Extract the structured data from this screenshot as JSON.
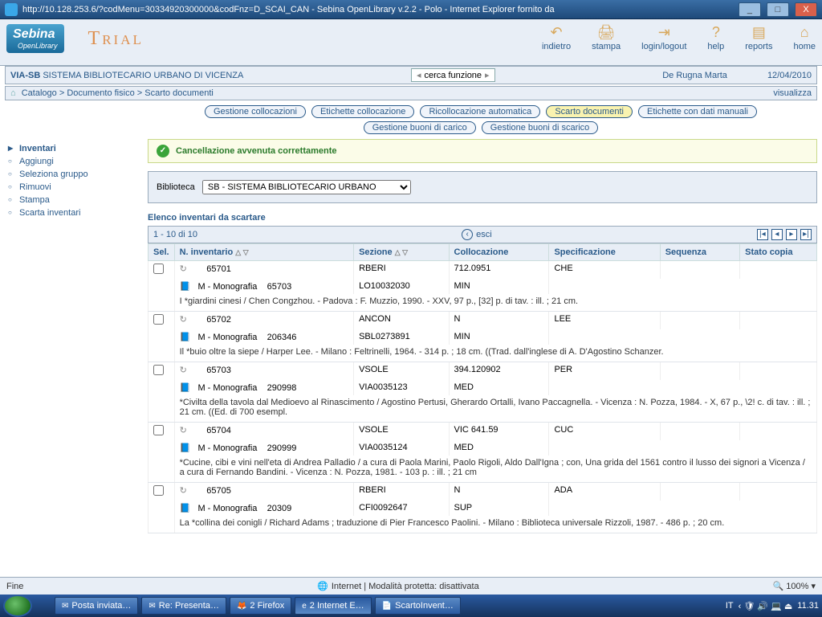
{
  "window": {
    "title": "http://10.128.253.6/?codMenu=30334920300000&codFnz=D_SCAI_CAN - Sebina OpenLibrary v.2.2 - Polo - Internet Explorer fornito da"
  },
  "brand": {
    "name": "Sebina",
    "sub": "OpenLibrary",
    "trial": "Trial"
  },
  "tb": {
    "indietro": "indietro",
    "stampa": "stampa",
    "login": "login/logout",
    "help": "help",
    "reports": "reports",
    "home": "home"
  },
  "sys": {
    "code": "VIA-SB",
    "name": "SISTEMA BIBLIOTECARIO URBANO DI VICENZA",
    "search": "cerca funzione",
    "user": "De Rugna Marta",
    "date": "12/04/2010"
  },
  "bc": {
    "a": "Catalogo",
    "b": "Documento fisico",
    "c": "Scarto documenti",
    "vis": "visualizza"
  },
  "pills": {
    "p1": "Gestione collocazioni",
    "p2": "Etichette collocazione",
    "p3": "Ricollocazione automatica",
    "p4": "Scarto documenti",
    "p5": "Etichette con dati manuali",
    "p6": "Gestione buoni di carico",
    "p7": "Gestione buoni di scarico"
  },
  "side": {
    "h1": "Inventari",
    "i1": "Aggiungi",
    "i2": "Seleziona gruppo",
    "i3": "Rimuovi",
    "i4": "Stampa",
    "h2": "Scarta inventari"
  },
  "msg": {
    "ok": "Cancellazione avvenuta correttamente"
  },
  "bib": {
    "label": "Biblioteca",
    "opt": "SB - SISTEMA BIBLIOTECARIO URBANO"
  },
  "list": {
    "title": "Elenco inventari da scartare",
    "range": "1 - 10 di 10",
    "esci": "esci"
  },
  "cols": {
    "sel": "Sel.",
    "ninv": "N. inventario",
    "sez": "Sezione",
    "coll": "Collocazione",
    "spec": "Specificazione",
    "seq": "Sequenza",
    "stato": "Stato copia"
  },
  "rows": [
    {
      "inv": "65701",
      "sez": "RBERI",
      "coll": "712.0951",
      "spec": "CHE",
      "type": "M - Monografia",
      "code": "65703",
      "code2": "LO10032030",
      "med": "MIN",
      "desc": "I *giardini cinesi / Chen Congzhou. - Padova : F. Muzzio, 1990. - XXV, 97 p., [32] p. di tav. : ill. ; 21 cm."
    },
    {
      "inv": "65702",
      "sez": "ANCON",
      "coll": "N",
      "spec": "LEE",
      "type": "M - Monografia",
      "code": "206346",
      "code2": "SBL0273891",
      "med": "MIN",
      "desc": "Il *buio oltre la siepe / Harper Lee. - Milano : Feltrinelli, 1964. - 314 p. ; 18 cm. ((Trad. dall'inglese di A. D'Agostino Schanzer."
    },
    {
      "inv": "65703",
      "sez": "VSOLE",
      "coll": "394.120902",
      "spec": "PER",
      "type": "M - Monografia",
      "code": "290998",
      "code2": "VIA0035123",
      "med": "MED",
      "desc": "*Civilta della tavola dal Medioevo al Rinascimento / Agostino Pertusi, Gherardo Ortalli, Ivano Paccagnella. - Vicenza : N. Pozza, 1984. - X, 67 p., \\2! c. di tav. : ill. ; 21 cm. ((Ed. di 700 esempl."
    },
    {
      "inv": "65704",
      "sez": "VSOLE",
      "coll": "VIC 641.59",
      "spec": "CUC",
      "type": "M - Monografia",
      "code": "290999",
      "code2": "VIA0035124",
      "med": "MED",
      "desc": "*Cucine, cibi e vini nell'eta di Andrea Palladio / a cura di Paola Marini, Paolo Rigoli, Aldo Dall'Igna ; con, Una grida del 1561 contro il lusso dei signori a Vicenza / a cura di Fernando Bandini. - Vicenza : N. Pozza, 1981. - 103 p. : ill. ; 21 cm"
    },
    {
      "inv": "65705",
      "sez": "RBERI",
      "coll": "N",
      "spec": "ADA",
      "type": "M - Monografia",
      "code": "20309",
      "code2": "CFI0092647",
      "med": "SUP",
      "desc": "La *collina dei conigli / Richard Adams ; traduzione di Pier Francesco Paolini. - Milano : Biblioteca universale Rizzoli, 1987. - 486 p. ; 20 cm."
    }
  ],
  "status": {
    "fine": "Fine",
    "net": "Internet | Modalità protetta: disattivata",
    "zoom": "100%"
  },
  "task": {
    "t1": "Posta inviata…",
    "t2": "Re: Presenta…",
    "t3": "2 Firefox",
    "t4": "2 Internet E…",
    "t5": "ScartoInvent…",
    "lang": "IT",
    "time": "11.31"
  }
}
